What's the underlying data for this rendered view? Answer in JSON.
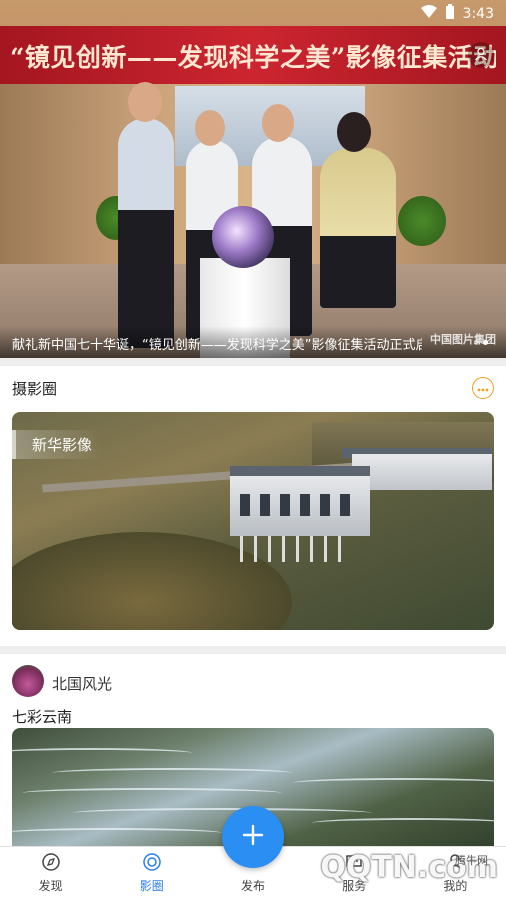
{
  "status_bar": {
    "time": "3:43"
  },
  "hero": {
    "banner_title": "“镜见创新——发现科学之美”影像征集活动启动仪式",
    "caption": "献礼新中国七十华诞，“镜见创新——发现科学之美”影像征集活动正式启动",
    "watermark": "中国图片集团",
    "slide_count": 2,
    "active_slide": 2
  },
  "photography_circle": {
    "title": "摄影圈",
    "more_icon": "more-dots-icon",
    "featured_tag": "新华影像"
  },
  "post": {
    "author": "北国风光",
    "title": "七彩云南"
  },
  "bottom_nav": {
    "items": [
      {
        "label": "发现",
        "icon": "discover-icon",
        "active": false
      },
      {
        "label": "影圈",
        "icon": "photo-circle-icon",
        "active": true
      },
      {
        "label": "发布",
        "icon": "publish-plus-icon",
        "active": false
      },
      {
        "label": "服务",
        "icon": "chat-icon",
        "active": false
      },
      {
        "label": "我的",
        "icon": "user-icon",
        "active": false
      }
    ]
  },
  "overlay_watermark": {
    "logo": "QQTN.com",
    "site": "腾牛网"
  },
  "colors": {
    "accent": "#2b8ef2",
    "active_tab": "#2b7de9",
    "more_button": "#f0a020"
  }
}
